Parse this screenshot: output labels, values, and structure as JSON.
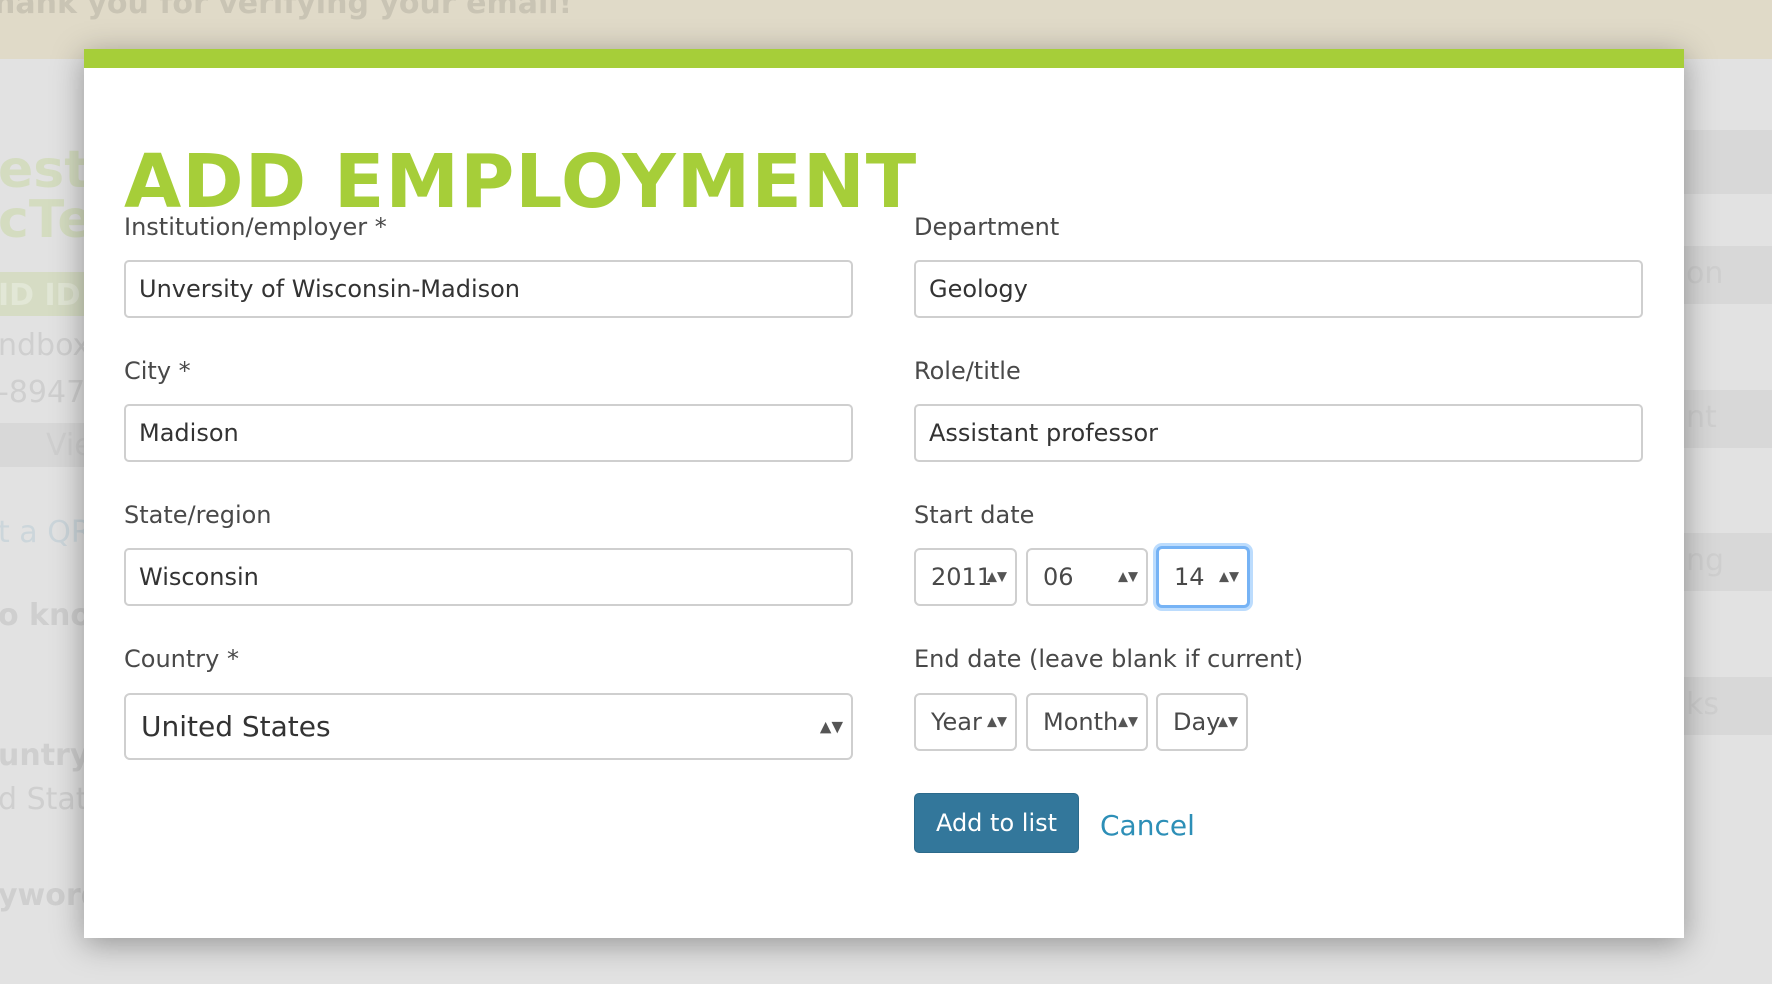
{
  "background": {
    "banner": "hank you for verifying your email!",
    "left_fragments": [
      "est",
      "cTe",
      "ID ID",
      "ndbox.",
      "-8947",
      "Vie",
      "t a QR",
      "o know",
      "untry",
      "d State",
      "yword"
    ],
    "right_fragments": [
      "on",
      "nt",
      "ng",
      "ks"
    ]
  },
  "modal": {
    "title": "ADD EMPLOYMENT",
    "accent_color": "#a6ce39",
    "fields": {
      "institution": {
        "label": "Institution/employer *",
        "value": "Unversity of Wisconsin-Madison"
      },
      "department": {
        "label": "Department",
        "value": "Geology"
      },
      "city": {
        "label": "City *",
        "value": "Madison"
      },
      "role": {
        "label": "Role/title",
        "value": "Assistant professor"
      },
      "state": {
        "label": "State/region",
        "value": "Wisconsin"
      },
      "country": {
        "label": "Country *",
        "value": "United States"
      }
    },
    "start_date": {
      "label": "Start date",
      "year": "2011",
      "month": "06",
      "day": "14"
    },
    "end_date": {
      "label": "End date (leave blank if current)",
      "year": "Year",
      "month": "Month",
      "day": "Day"
    },
    "add_button": "Add to list",
    "cancel_link": "Cancel",
    "button_color": "#33779b"
  }
}
